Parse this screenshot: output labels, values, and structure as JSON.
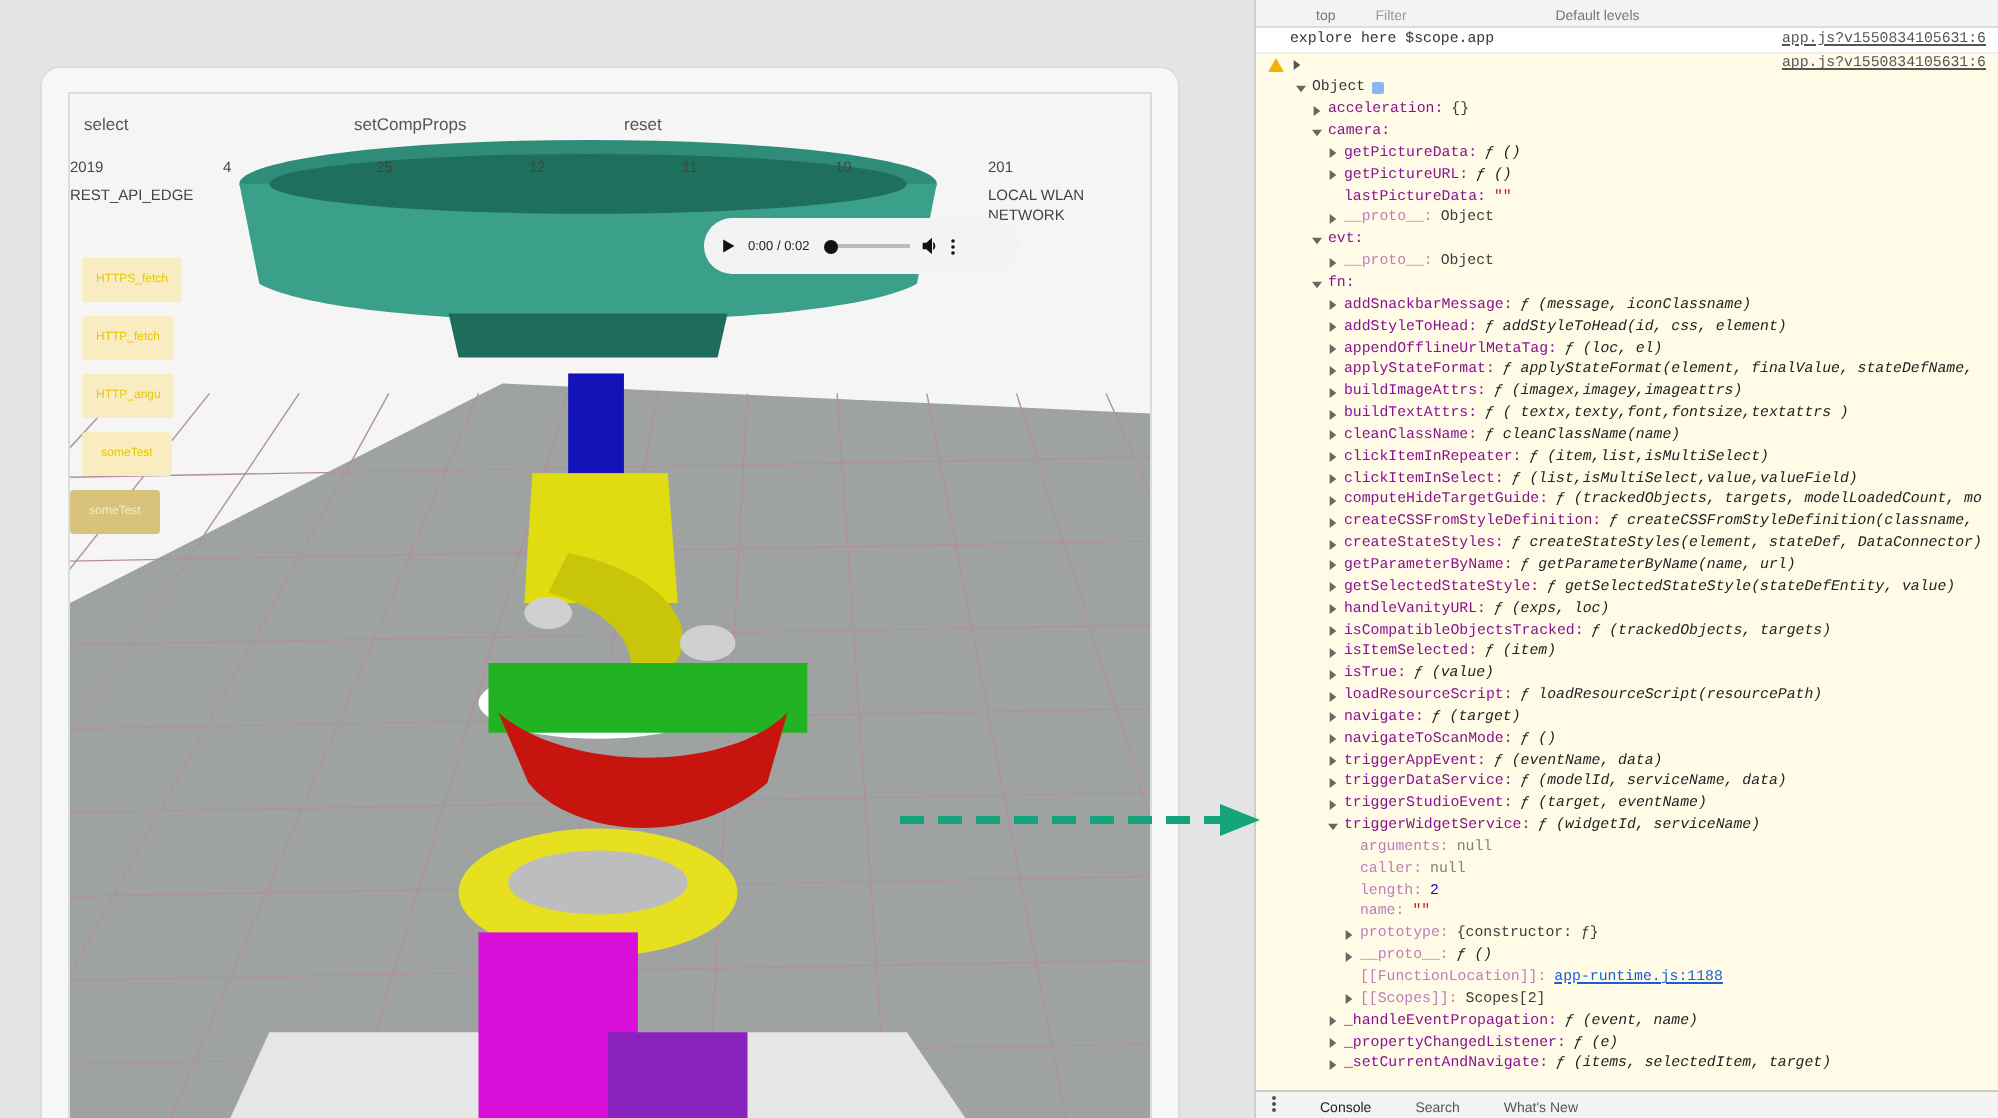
{
  "app": {
    "actions": [
      {
        "label": "select"
      },
      {
        "label": "setCompProps"
      },
      {
        "label": "reset"
      }
    ],
    "metrics": [
      {
        "value": "2019",
        "label": "REST_API_EDGE"
      },
      {
        "value": "4"
      },
      {
        "value": "25"
      },
      {
        "value": "12"
      },
      {
        "value": "11"
      },
      {
        "value": "10"
      },
      {
        "value": "201",
        "label": "LOCAL WLAN NETWORK"
      }
    ],
    "side_buttons": [
      {
        "label": "HTTPS_fetch",
        "selected": false
      },
      {
        "label": "HTTP_fetch",
        "selected": false
      },
      {
        "label": "HTTP_angu",
        "selected": false
      },
      {
        "label": "someTest",
        "selected": false
      },
      {
        "label": "someTest",
        "selected": true
      }
    ],
    "audio_player": {
      "time": "0:00 / 0:02",
      "level": 0
    }
  },
  "devtools": {
    "toolbar": {
      "context": "top",
      "filter_placeholder": "Filter",
      "levels": "Default levels"
    },
    "messages": [
      {
        "kind": "log",
        "text": "explore here $scope.app",
        "source": "app.js?v1550834105631:6"
      },
      {
        "kind": "warning",
        "source": "app.js?v1550834105631:6"
      }
    ],
    "tree": [
      {
        "key": "Object",
        "info": true,
        "expanded": true,
        "children": [
          {
            "key": "acceleration:",
            "value": "{}",
            "kind": "object",
            "expanded": false
          },
          {
            "key": "camera:",
            "expanded": true,
            "children": [
              {
                "key": "getPictureData:",
                "value": "ƒ ()",
                "kind": "function",
                "expanded": false
              },
              {
                "key": "getPictureURL:",
                "value": "ƒ ()",
                "kind": "function",
                "expanded": false
              },
              {
                "key": "lastPictureData:",
                "value": "\"\"",
                "kind": "string"
              },
              {
                "key": "__proto__:",
                "value": "Object",
                "kind": "object",
                "dim": true,
                "expanded": false
              }
            ]
          },
          {
            "key": "evt:",
            "expanded": true,
            "children": [
              {
                "key": "__proto__:",
                "value": "Object",
                "kind": "object",
                "dim": true,
                "expanded": false
              }
            ]
          },
          {
            "key": "fn:",
            "expanded": true,
            "children": [
              {
                "key": "addSnackbarMessage:",
                "value": "ƒ (message, iconClassname)",
                "kind": "function",
                "expanded": false
              },
              {
                "key": "addStyleToHead:",
                "value": "ƒ addStyleToHead(id, css, element)",
                "kind": "function",
                "expanded": false
              },
              {
                "key": "appendOfflineUrlMetaTag:",
                "value": "ƒ (loc, el)",
                "kind": "function",
                "expanded": false
              },
              {
                "key": "applyStateFormat:",
                "value": "ƒ applyStateFormat(element, finalValue, stateDefName,",
                "kind": "function",
                "expanded": false
              },
              {
                "key": "buildImageAttrs:",
                "value": "ƒ (imagex,imagey,imageattrs)",
                "kind": "function",
                "expanded": false
              },
              {
                "key": "buildTextAttrs:",
                "value": "ƒ ( textx,texty,font,fontsize,textattrs )",
                "kind": "function",
                "expanded": false
              },
              {
                "key": "cleanClassName:",
                "value": "ƒ cleanClassName(name)",
                "kind": "function",
                "expanded": false
              },
              {
                "key": "clickItemInRepeater:",
                "value": "ƒ (item,list,isMultiSelect)",
                "kind": "function",
                "expanded": false
              },
              {
                "key": "clickItemInSelect:",
                "value": "ƒ (list,isMultiSelect,value,valueField)",
                "kind": "function",
                "expanded": false
              },
              {
                "key": "computeHideTargetGuide:",
                "value": "ƒ (trackedObjects, targets, modelLoadedCount, mo",
                "kind": "function",
                "expanded": false
              },
              {
                "key": "createCSSFromStyleDefinition:",
                "value": "ƒ createCSSFromStyleDefinition(classname,",
                "kind": "function",
                "expanded": false
              },
              {
                "key": "createStateStyles:",
                "value": "ƒ createStateStyles(element, stateDef, DataConnector)",
                "kind": "function",
                "expanded": false
              },
              {
                "key": "getParameterByName:",
                "value": "ƒ getParameterByName(name, url)",
                "kind": "function",
                "expanded": false
              },
              {
                "key": "getSelectedStateStyle:",
                "value": "ƒ getSelectedStateStyle(stateDefEntity, value)",
                "kind": "function",
                "expanded": false
              },
              {
                "key": "handleVanityURL:",
                "value": "ƒ (exps, loc)",
                "kind": "function",
                "expanded": false
              },
              {
                "key": "isCompatibleObjectsTracked:",
                "value": "ƒ (trackedObjects, targets)",
                "kind": "function",
                "expanded": false
              },
              {
                "key": "isItemSelected:",
                "value": "ƒ (item)",
                "kind": "function",
                "expanded": false
              },
              {
                "key": "isTrue:",
                "value": "ƒ (value)",
                "kind": "function",
                "expanded": false
              },
              {
                "key": "loadResourceScript:",
                "value": "ƒ loadResourceScript(resourcePath)",
                "kind": "function",
                "expanded": false
              },
              {
                "key": "navigate:",
                "value": "ƒ (target)",
                "kind": "function",
                "expanded": false
              },
              {
                "key": "navigateToScanMode:",
                "value": "ƒ ()",
                "kind": "function",
                "expanded": false
              },
              {
                "key": "triggerAppEvent:",
                "value": "ƒ (eventName, data)",
                "kind": "function",
                "expanded": false
              },
              {
                "key": "triggerDataService:",
                "value": "ƒ (modelId, serviceName, data)",
                "kind": "function",
                "expanded": false
              },
              {
                "key": "triggerStudioEvent:",
                "value": "ƒ (target, eventName)",
                "kind": "function",
                "expanded": false
              },
              {
                "key": "triggerWidgetService:",
                "value": "ƒ (widgetId, serviceName)",
                "kind": "function",
                "expanded": true,
                "children": [
                  {
                    "key": "arguments:",
                    "value": "null",
                    "kind": "null",
                    "dim": true
                  },
                  {
                    "key": "caller:",
                    "value": "null",
                    "kind": "null",
                    "dim": true
                  },
                  {
                    "key": "length:",
                    "value": "2",
                    "kind": "number",
                    "dim": true
                  },
                  {
                    "key": "name:",
                    "value": "\"\"",
                    "kind": "string",
                    "dim": true
                  },
                  {
                    "key": "prototype:",
                    "value": "{constructor: ƒ}",
                    "kind": "object",
                    "dim": true,
                    "expanded": false
                  },
                  {
                    "key": "__proto__:",
                    "value": "ƒ ()",
                    "kind": "function",
                    "dim": true,
                    "expanded": false
                  },
                  {
                    "key": "[[FunctionLocation]]:",
                    "value": "app-runtime.js:1188",
                    "kind": "link",
                    "dim": true
                  },
                  {
                    "key": "[[Scopes]]:",
                    "value": "Scopes[2]",
                    "kind": "object",
                    "dim": true,
                    "expanded": false
                  }
                ]
              },
              {
                "key": "_handleEventPropagation:",
                "value": "ƒ (event, name)",
                "kind": "function",
                "expanded": false
              },
              {
                "key": "_propertyChangedListener:",
                "value": "ƒ (e)",
                "kind": "function",
                "expanded": false
              },
              {
                "key": "_setCurrentAndNavigate:",
                "value": "ƒ (items, selectedItem, target)",
                "kind": "function",
                "expanded": false
              }
            ]
          }
        ]
      }
    ],
    "drawer_tabs": [
      {
        "label": "Console",
        "selected": true
      },
      {
        "label": "Search",
        "selected": false
      },
      {
        "label": "What's New",
        "selected": false
      }
    ]
  }
}
